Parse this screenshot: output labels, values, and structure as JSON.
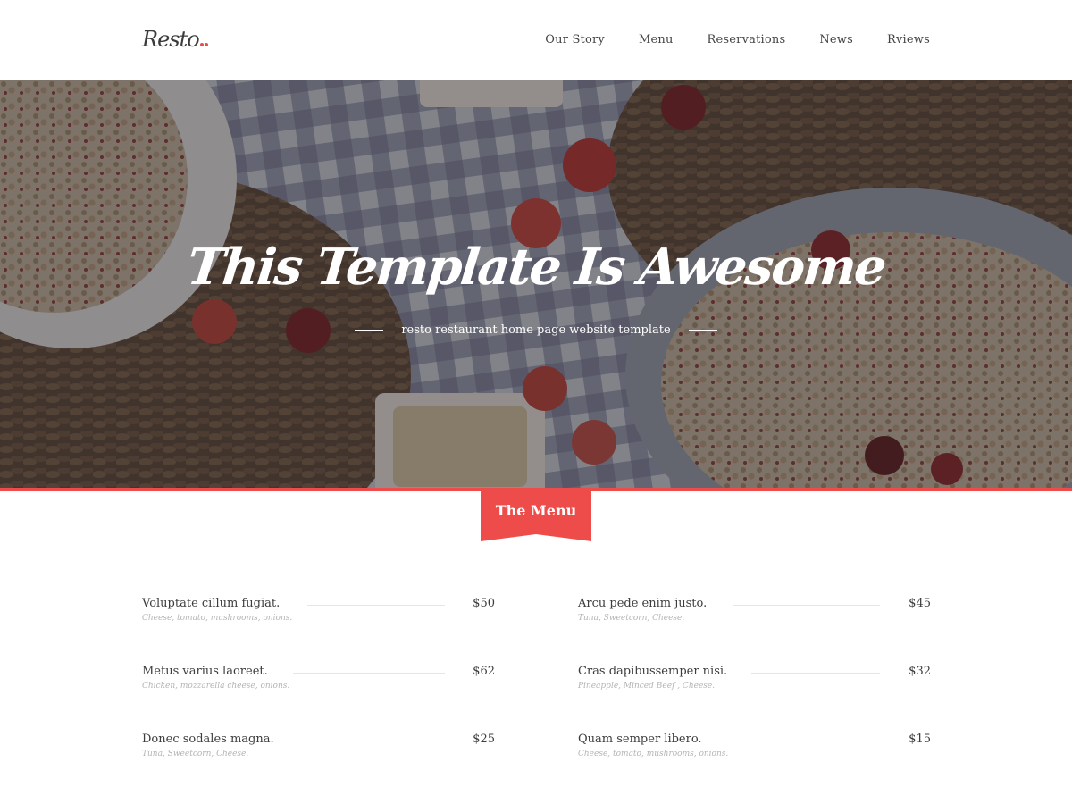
{
  "brand": {
    "logo_text": "Resto",
    "accent_color": "#ee4b4b"
  },
  "nav": {
    "items": [
      {
        "label": "Our Story"
      },
      {
        "label": "Menu"
      },
      {
        "label": "Reservations"
      },
      {
        "label": "News"
      },
      {
        "label": "Rviews"
      }
    ]
  },
  "hero": {
    "title": "This Template Is Awesome",
    "subtitle": "resto restaurant home page website template"
  },
  "menu_section": {
    "ribbon_label": "The Menu",
    "left": [
      {
        "name": "Voluptate cillum fugiat.",
        "desc": "Cheese, tomato, mushrooms, onions.",
        "price": "$50"
      },
      {
        "name": "Metus varius laoreet.",
        "desc": "Chicken, mozzarella cheese, onions.",
        "price": "$62"
      },
      {
        "name": "Donec sodales magna.",
        "desc": "Tuna, Sweetcorn, Cheese.",
        "price": "$25"
      }
    ],
    "right": [
      {
        "name": "Arcu pede enim justo.",
        "desc": "Tuna, Sweetcorn, Cheese.",
        "price": "$45"
      },
      {
        "name": "Cras dapibussemper nisi.",
        "desc": "Pineapple, Minced Beef , Cheese.",
        "price": "$32"
      },
      {
        "name": "Quam semper libero.",
        "desc": "Cheese, tomato, mushrooms, onions.",
        "price": "$15"
      }
    ]
  }
}
